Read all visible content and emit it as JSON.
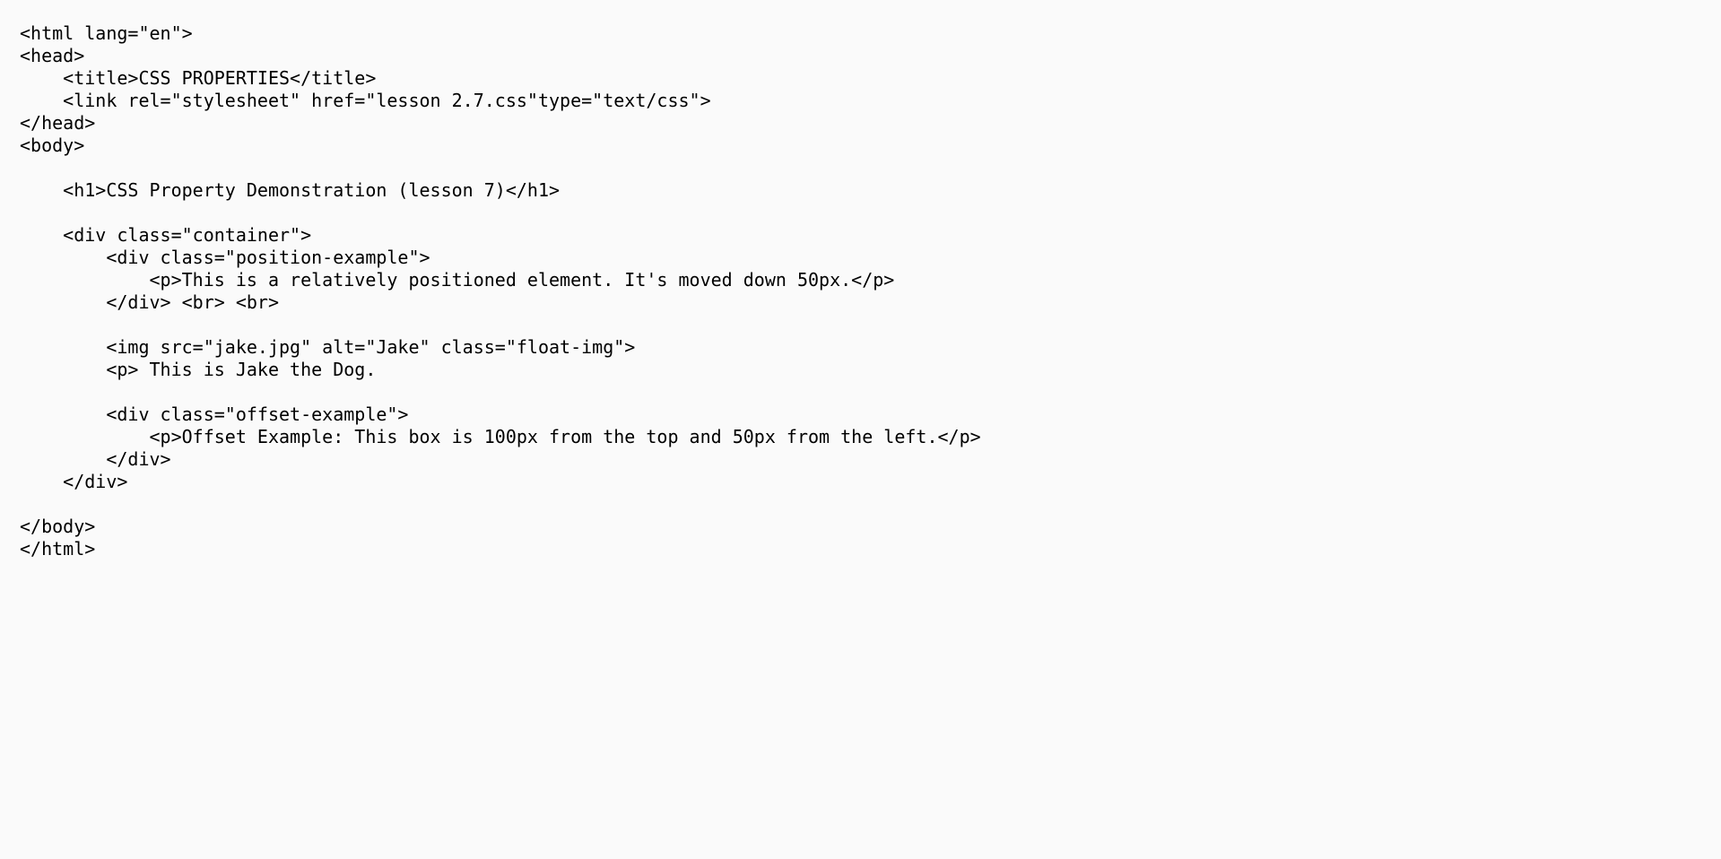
{
  "source_lines": [
    "<html lang=\"en\">",
    "<head>",
    "    <title>CSS PROPERTIES</title>",
    "    <link rel=\"stylesheet\" href=\"lesson 2.7.css\"type=\"text/css\">",
    "</head>",
    "<body>",
    "",
    "    <h1>CSS Property Demonstration (lesson 7)</h1>",
    "",
    "    <div class=\"container\">",
    "        <div class=\"position-example\">",
    "            <p>This is a relatively positioned element. It's moved down 50px.</p>",
    "        </div> <br> <br>",
    "",
    "        <img src=\"jake.jpg\" alt=\"Jake\" class=\"float-img\">",
    "        <p> This is Jake the Dog.",
    "",
    "        <div class=\"offset-example\">",
    "            <p>Offset Example: This box is 100px from the top and 50px from the left.</p>",
    "        </div>",
    "    </div>",
    "",
    "</body>",
    "</html>"
  ]
}
